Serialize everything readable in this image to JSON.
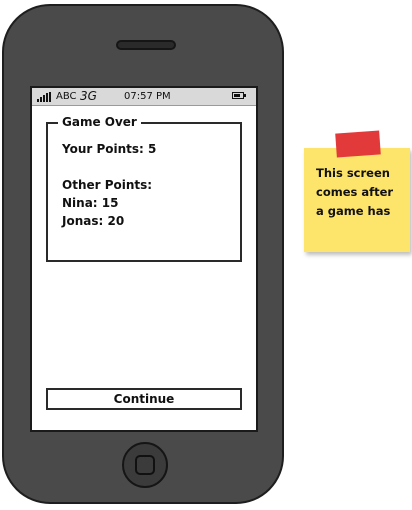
{
  "status_bar": {
    "carrier": "ABC",
    "network": "3G",
    "time": "07:57 PM"
  },
  "panel": {
    "title": "Game Over",
    "your_points": "Your Points: 5",
    "other_points_label": "Other Points:",
    "players": [
      "Nina: 15",
      "Jonas: 20"
    ]
  },
  "continue_button": {
    "label": "Continue"
  },
  "note": {
    "lines": [
      "This screen",
      "comes after",
      "a game has"
    ]
  },
  "colors": {
    "phone_body": "#4a4a4a",
    "note_yellow": "#fde46a",
    "tape_red": "#e23a3a"
  }
}
